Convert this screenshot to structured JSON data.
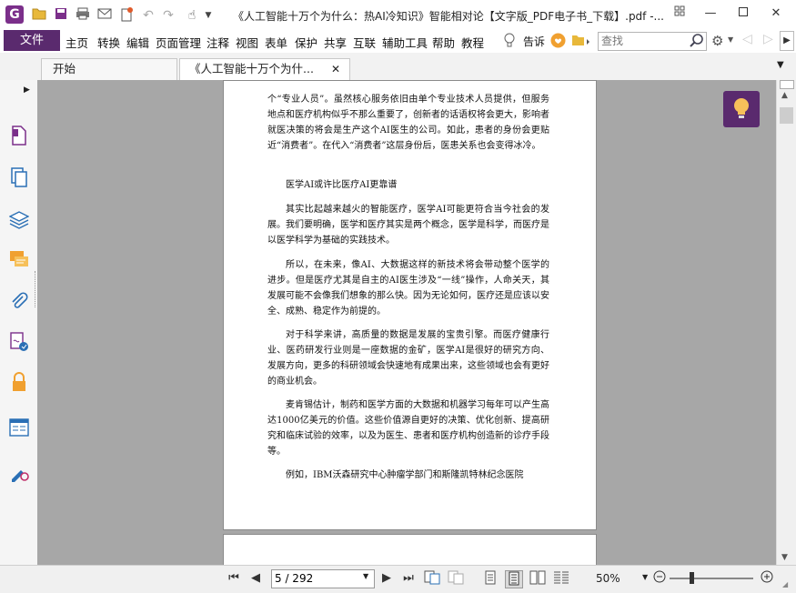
{
  "titlebar": {
    "app_icon": "G",
    "title": "《人工智能十万个为什么：热AI冷知识》智能相对论【文字版_PDF电子书_下载】.pdf -..."
  },
  "menu": {
    "file": "文件",
    "items": [
      "主页",
      "转换",
      "编辑",
      "页面管理",
      "注释",
      "视图",
      "表单",
      "保护",
      "共享",
      "互联",
      "辅助工具",
      "帮助",
      "教程"
    ],
    "tell_me": "告诉",
    "search_placeholder": "查找"
  },
  "tabs": [
    {
      "label": "开始"
    },
    {
      "label": "《人工智能十万个为什..."
    }
  ],
  "document": {
    "paragraphs": [
      "个“专业人员”。虽然核心服务依旧由单个专业技术人员提供，但服务地点和医疗机构似乎不那么重要了，创新者的话语权将会更大，影响者就医决策的将会是生产这个AI医生的公司。如此，患者的身份会更贴近“消费者”。在代入“消费者”这层身份后，医患关系也会变得冰冷。",
      "医学AI或许比医疗AI更靠谱",
      "其实比起越来越火的智能医疗，医学AI可能更符合当今社会的发展。我们要明确，医学和医疗其实是两个概念，医学是科学，而医疗是以医学科学为基础的实践技术。",
      "所以，在未来，像AI、大数据这样的新技术将会带动整个医学的进步。但是医疗尤其是自主的AI医生涉及“一线”操作，人命关天，其发展可能不会像我们想象的那么快。因为无论如何，医疗还是应该以安全、成熟、稳定作为前提的。",
      "对于科学来讲，高质量的数据是发展的宝贵引擎。而医疗健康行业、医药研发行业则是一座数据的金矿，医学AI是很好的研究方向、发展方向，更多的科研领域会快速地有成果出来，这些领域也会有更好的商业机会。",
      "麦肯锡估计，制药和医学方面的大数据和机器学习每年可以产生高达1000亿美元的价值。这些价值源自更好的决策、优化创新、提高研究和临床试验的效率，以及为医生、患者和医疗机构创造新的诊疗手段等。",
      "例如，IBM沃森研究中心肿瘤学部门和斯隆凯特林纪念医院"
    ]
  },
  "statusbar": {
    "page_value": "5 / 292",
    "zoom": "50%"
  },
  "colors": {
    "brand": "#5a2a6e",
    "doc_background": "#a7a7a7"
  }
}
